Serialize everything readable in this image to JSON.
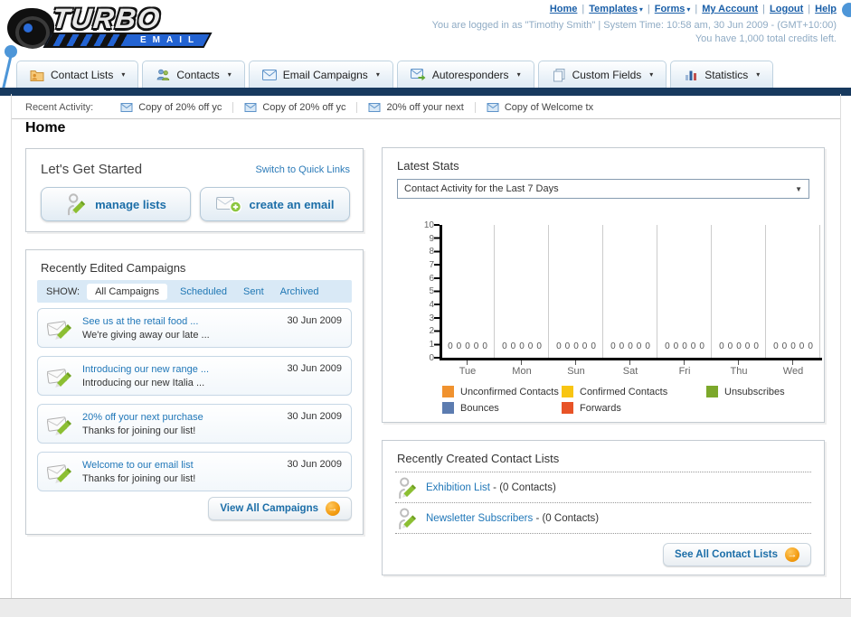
{
  "icons": {
    "caret_down": "▾",
    "select_caret": "▼",
    "arrow_right": "→",
    "separator": "|"
  },
  "colors": {
    "navy_bar": "#17395e",
    "link_blue": "#1a5fa8",
    "panel_border": "#c4cbd1",
    "show_bar_bg": "#d9e9f6",
    "annotation_pin": "#4d96d8"
  },
  "header": {
    "logo_title": "TURBO",
    "logo_subtitle": "EMAIL",
    "links": [
      {
        "label": "Home",
        "has_dropdown": false
      },
      {
        "label": "Templates",
        "has_dropdown": true
      },
      {
        "label": "Forms",
        "has_dropdown": true
      },
      {
        "label": "My Account",
        "has_dropdown": false
      },
      {
        "label": "Logout",
        "has_dropdown": false
      },
      {
        "label": "Help",
        "has_dropdown": false
      }
    ],
    "login_info": "You are logged in as \"Timothy Smith\" | System Time: 10:58 am, 30 Jun 2009 - (GMT+10:00)",
    "credits_info": "You have 1,000 total credits left."
  },
  "nav": {
    "tabs": [
      {
        "label": "Contact Lists"
      },
      {
        "label": "Contacts"
      },
      {
        "label": "Email Campaigns"
      },
      {
        "label": "Autoresponders"
      },
      {
        "label": "Custom Fields"
      },
      {
        "label": "Statistics"
      }
    ]
  },
  "recent_activity": {
    "label": "Recent Activity:",
    "items": [
      "Copy of 20% off yc",
      "Copy of 20% off yc",
      "20% off your next ",
      "Copy of Welcome tx"
    ]
  },
  "page": {
    "title": "Home"
  },
  "get_started": {
    "title": "Let's Get Started",
    "switch_link": "Switch to Quick Links",
    "manage_lists_label": "manage lists",
    "create_email_label": "create an email"
  },
  "campaigns": {
    "title": "Recently Edited Campaigns",
    "show_label": "SHOW:",
    "filters": [
      {
        "label": "All Campaigns",
        "active": true
      },
      {
        "label": "Scheduled",
        "active": false
      },
      {
        "label": "Sent",
        "active": false
      },
      {
        "label": "Archived",
        "active": false
      }
    ],
    "items": [
      {
        "title": "See us at the retail food ...",
        "subtitle": "We're giving away our late ...",
        "date": "30 Jun 2009"
      },
      {
        "title": "Introducing our new range ...",
        "subtitle": "Introducing our new Italia ...",
        "date": "30 Jun 2009"
      },
      {
        "title": "20% off your next purchase",
        "subtitle": "Thanks for joining our list!",
        "date": "30 Jun 2009"
      },
      {
        "title": "Welcome to our email list",
        "subtitle": "Thanks for joining our list!",
        "date": "30 Jun 2009"
      }
    ],
    "view_all_label": "View All Campaigns"
  },
  "stats": {
    "title": "Latest Stats",
    "dropdown_value": "Contact Activity for the Last 7 Days"
  },
  "chart_data": {
    "type": "bar",
    "title": "Contact Activity for the Last 7 Days",
    "categories": [
      "Tue",
      "Mon",
      "Sun",
      "Sat",
      "Fri",
      "Thu",
      "Wed"
    ],
    "yticks": [
      "10",
      "9",
      "8",
      "7",
      "6",
      "5",
      "4",
      "3",
      "2",
      "1",
      "0"
    ],
    "ylim": [
      0,
      10
    ],
    "grid": true,
    "legend_position": "bottom",
    "zero_label": "0",
    "series": [
      {
        "name": "Unconfirmed Contacts",
        "color": "#f0922f",
        "values": [
          0,
          0,
          0,
          0,
          0,
          0,
          0
        ]
      },
      {
        "name": "Confirmed Contacts",
        "color": "#f8c513",
        "values": [
          0,
          0,
          0,
          0,
          0,
          0,
          0
        ]
      },
      {
        "name": "Unsubscribes",
        "color": "#7ca82b",
        "values": [
          0,
          0,
          0,
          0,
          0,
          0,
          0
        ]
      },
      {
        "name": "Bounces",
        "color": "#5c7cb0",
        "values": [
          0,
          0,
          0,
          0,
          0,
          0,
          0
        ]
      },
      {
        "name": "Forwards",
        "color": "#e85327",
        "values": [
          0,
          0,
          0,
          0,
          0,
          0,
          0
        ]
      }
    ]
  },
  "contact_lists": {
    "title": "Recently Created Contact Lists",
    "items": [
      {
        "name": "Exhibition List",
        "detail": "- (0 Contacts)"
      },
      {
        "name": "Newsletter Subscribers",
        "detail": "- (0 Contacts)"
      }
    ],
    "see_all_label": "See All Contact Lists"
  }
}
